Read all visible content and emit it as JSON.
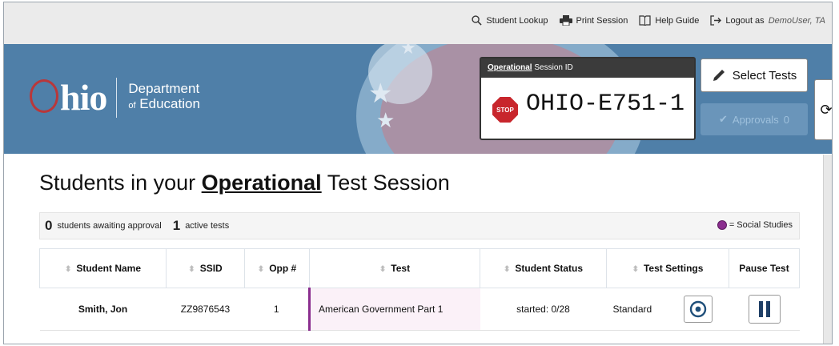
{
  "topnav": {
    "student_lookup": "Student Lookup",
    "print_session": "Print Session",
    "help_guide": "Help Guide",
    "logout_prefix": "Logout as",
    "user": "DemoUser, TA"
  },
  "logo": {
    "department": "Department",
    "of": "of",
    "education": "Education",
    "brand": "hio"
  },
  "session": {
    "type_label": "Operational",
    "id_label": "Session ID",
    "stop": "STOP",
    "id": "OHIO-E751-1"
  },
  "buttons": {
    "select_tests": "Select Tests",
    "approvals": "Approvals",
    "approvals_count": "0"
  },
  "heading": {
    "pre": "Students in your",
    "strong": "Operational",
    "post": "Test Session"
  },
  "status": {
    "awaiting_count": "0",
    "awaiting_label": "students awaiting approval",
    "active_count": "1",
    "active_label": "active tests",
    "legend": "= Social Studies"
  },
  "table": {
    "headers": [
      "Student Name",
      "SSID",
      "Opp #",
      "Test",
      "Student Status",
      "Test Settings",
      "Pause Test"
    ],
    "rows": [
      {
        "name": "Smith, Jon",
        "ssid": "ZZ9876543",
        "opp": "1",
        "test": "American Government Part 1",
        "status": "started: 0/28",
        "settings": "Standard"
      }
    ]
  },
  "colors": {
    "banner": "#4f7fa8",
    "social_studies": "#8a2d8e",
    "stop": "#c8262c"
  }
}
